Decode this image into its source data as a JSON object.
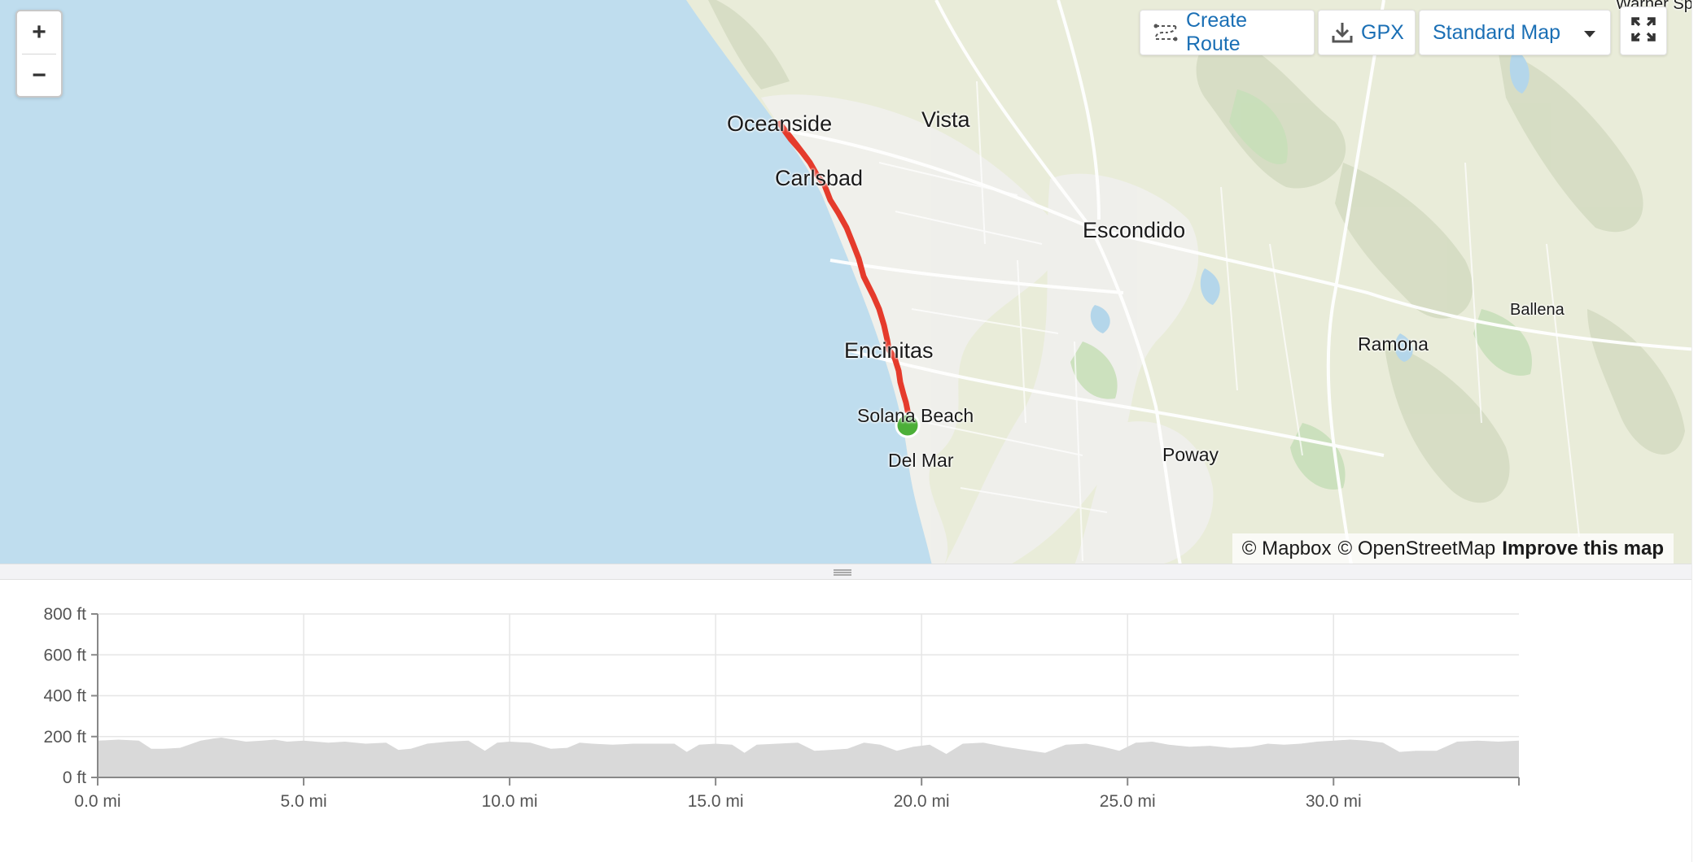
{
  "map": {
    "labels": {
      "oceanside": "Oceanside",
      "vista": "Vista",
      "carlsbad": "Carlsbad",
      "escondido": "Escondido",
      "encinitas": "Encinitas",
      "solana_beach": "Solana Beach",
      "del_mar": "Del Mar",
      "poway": "Poway",
      "ramona": "Ramona",
      "ballena": "Ballena",
      "warner_springs": "Warner Spr"
    },
    "route_color": "#e53b2c",
    "start_marker_color": "#4caf38",
    "water_color": "#bfddee",
    "land_color": "#e9ecd9"
  },
  "zoom": {
    "in_label": "+",
    "out_label": "−"
  },
  "toolbar": {
    "create_route_label": "Create Route",
    "create_route_icon": "route-icon",
    "gpx_label": "GPX",
    "gpx_icon": "download-icon",
    "map_style_label": "Standard Map",
    "map_style_icon": "caret-down-icon",
    "fullscreen_icon": "fullscreen-icon"
  },
  "attribution": {
    "mapbox": "© Mapbox",
    "osm": "© OpenStreetMap",
    "improve": "Improve this map"
  },
  "chart_data": {
    "type": "area",
    "title": "",
    "xlabel": "",
    "ylabel": "",
    "ylim": [
      0,
      800
    ],
    "xlim": [
      0,
      34.5
    ],
    "y_ticks": [
      "0 ft",
      "200 ft",
      "400 ft",
      "600 ft",
      "800 ft"
    ],
    "x_ticks": [
      "0.0 mi",
      "5.0 mi",
      "10.0 mi",
      "15.0 mi",
      "20.0 mi",
      "25.0 mi",
      "30.0 mi"
    ],
    "x_tick_values": [
      0,
      5,
      10,
      15,
      20,
      25,
      30
    ],
    "y_tick_values": [
      0,
      200,
      400,
      600,
      800
    ],
    "grid": true,
    "fill_color": "#d9d9d9",
    "series": [
      {
        "x": [
          0,
          0.5,
          1.0,
          1.3,
          1.6,
          2.0,
          2.5,
          2.8,
          3.0,
          3.3,
          3.6,
          4.0,
          4.3,
          4.6,
          5.0,
          5.3,
          5.6,
          6.0,
          6.5,
          7.0,
          7.3,
          7.6,
          8.0,
          8.5,
          9.0,
          9.4,
          9.7,
          10.0,
          10.5,
          11.0,
          11.4,
          11.7,
          12.0,
          12.5,
          13.0,
          13.5,
          14.0,
          14.3,
          14.6,
          15.0,
          15.4,
          15.7,
          16.0,
          16.5,
          17.0,
          17.4,
          17.8,
          18.2,
          18.6,
          19.0,
          19.4,
          19.8,
          20.2,
          20.6,
          21.0,
          21.5,
          22.0,
          22.5,
          23.0,
          23.5,
          24.0,
          24.4,
          24.8,
          25.2,
          25.6,
          26.0,
          26.5,
          27.0,
          27.5,
          28.0,
          28.4,
          28.8,
          29.2,
          29.6,
          30.0,
          30.4,
          30.8,
          31.2,
          31.6,
          32.0,
          32.5,
          33.0,
          33.5,
          34.0,
          34.5
        ],
        "values": [
          180,
          185,
          180,
          140,
          140,
          145,
          180,
          190,
          195,
          185,
          175,
          180,
          185,
          175,
          180,
          175,
          170,
          175,
          165,
          170,
          135,
          140,
          165,
          175,
          180,
          130,
          170,
          175,
          170,
          140,
          145,
          170,
          165,
          160,
          165,
          165,
          165,
          125,
          160,
          165,
          160,
          120,
          160,
          165,
          170,
          130,
          135,
          140,
          170,
          160,
          130,
          150,
          160,
          115,
          165,
          170,
          150,
          135,
          120,
          160,
          165,
          150,
          130,
          170,
          175,
          160,
          150,
          155,
          145,
          150,
          165,
          160,
          165,
          175,
          180,
          185,
          180,
          170,
          125,
          130,
          130,
          175,
          180,
          175,
          180
        ]
      }
    ]
  }
}
